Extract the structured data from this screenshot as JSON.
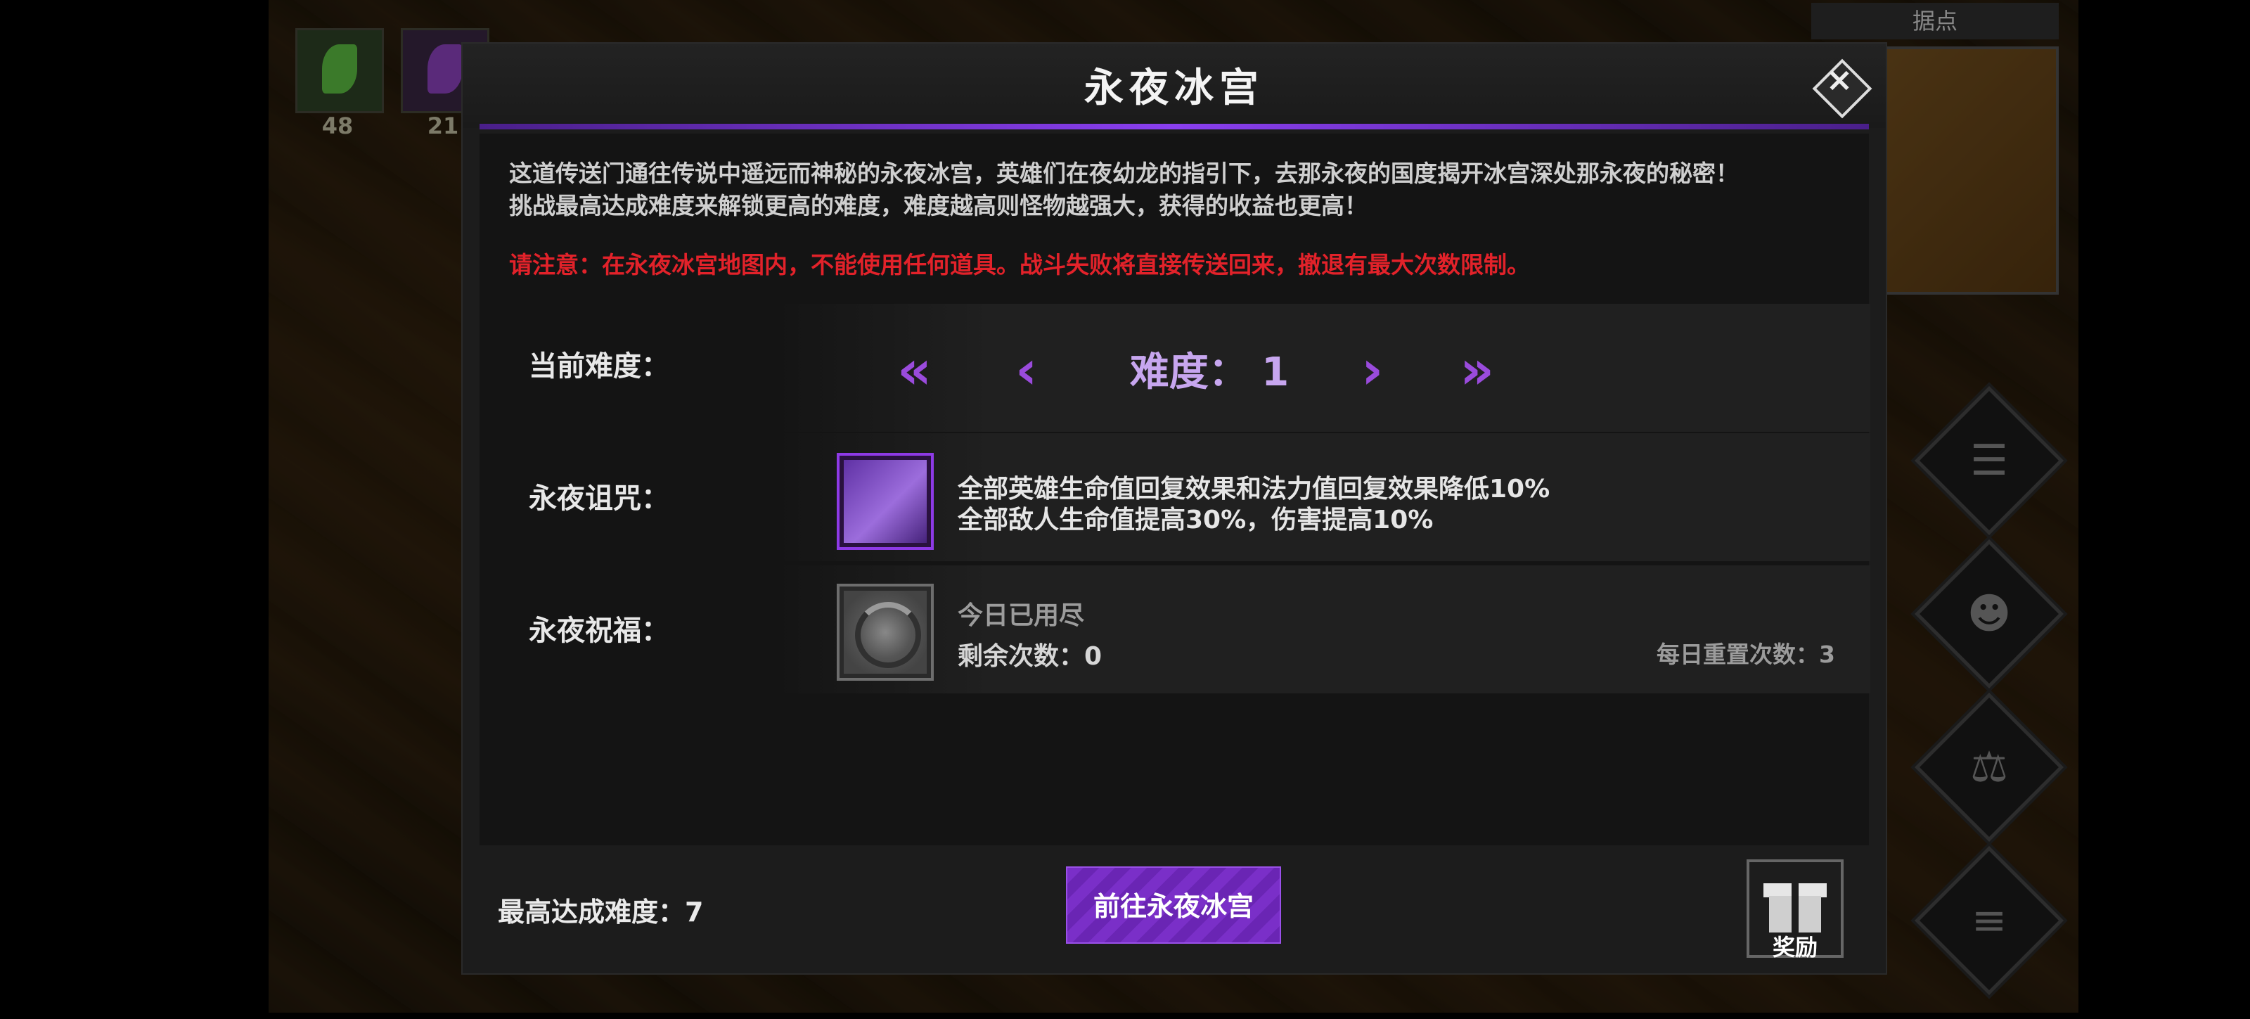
{
  "hud": {
    "items": [
      {
        "count": "48",
        "color": "#3b7a2a"
      },
      {
        "count": "21",
        "color": "#5a2a7a"
      }
    ]
  },
  "minimap": {
    "label": "据点"
  },
  "side_buttons": [
    {
      "icon": "scroll-icon"
    },
    {
      "icon": "heroes-icon"
    },
    {
      "icon": "potion-icon"
    },
    {
      "icon": "menu-list-icon"
    }
  ],
  "dialog": {
    "title": "永夜冰宫",
    "close": "×",
    "description": [
      "这道传送门通往传说中遥远而神秘的永夜冰宫，英雄们在夜幼龙的指引下，去那永夜的国度揭开冰宫深处那永夜的秘密！",
      "挑战最高达成难度来解锁更高的难度，难度越高则怪物越强大，获得的收益也更高！"
    ],
    "warning": "请注意：在永夜冰宫地图内，不能使用任何道具。战斗失败将直接传送回来，撤退有最大次数限制。",
    "difficulty": {
      "label": "当前难度：",
      "prefix": "难度：",
      "value": "1",
      "first_arrow": "«",
      "prev_arrow": "‹",
      "next_arrow": "›",
      "last_arrow": "»"
    },
    "curse": {
      "label": "永夜诅咒：",
      "icon": "bats-icon",
      "effects": [
        "全部英雄生命值回复效果和法力值回复效果降低10%",
        "全部敌人生命值提高30%，伤害提高10%"
      ]
    },
    "blessing": {
      "label": "永夜祝福：",
      "icon": "swirl-icon",
      "status": "今日已用尽",
      "remaining": "剩余次数：0",
      "daily_reset": "每日重置次数：3"
    },
    "footer": {
      "max_difficulty": "最高达成难度：7",
      "go_button": "前往永夜冰宫",
      "reward_label": "奖励"
    }
  },
  "colors": {
    "accent_purple": "#8a3ff0",
    "warning_red": "#e2222a",
    "difficulty_text": "#c7a6ef"
  }
}
